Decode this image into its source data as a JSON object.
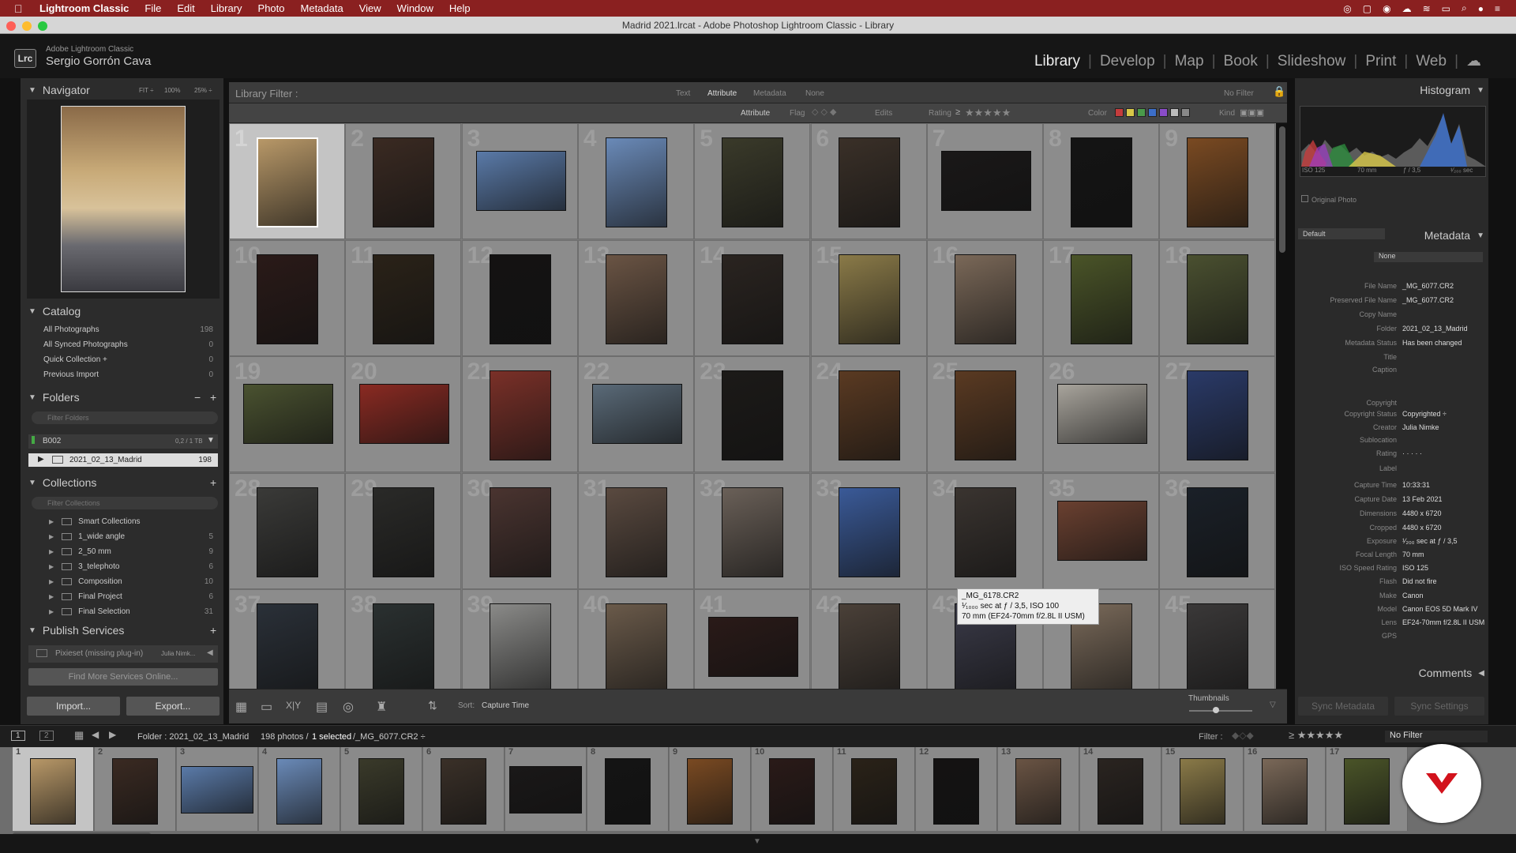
{
  "menubar": {
    "app_name": "Lightroom Classic",
    "items": [
      "File",
      "Edit",
      "Library",
      "Photo",
      "Metadata",
      "View",
      "Window",
      "Help"
    ]
  },
  "window_title": "Madrid 2021.lrcat - Adobe Photoshop Lightroom Classic - Library",
  "identity": {
    "logo": "Lrc",
    "product": "Adobe Lightroom Classic",
    "user": "Sergio Gorrón Cava"
  },
  "modules": {
    "items": [
      "Library",
      "Develop",
      "Map",
      "Book",
      "Slideshow",
      "Print",
      "Web"
    ],
    "active": "Library"
  },
  "navigator": {
    "title": "Navigator",
    "zoom_options": [
      "FIT ÷",
      "100%",
      "25% ÷"
    ]
  },
  "catalog": {
    "title": "Catalog",
    "items": [
      {
        "label": "All Photographs",
        "count": "198"
      },
      {
        "label": "All Synced Photographs",
        "count": "0"
      },
      {
        "label": "Quick Collection +",
        "count": "0"
      },
      {
        "label": "Previous Import",
        "count": "0"
      }
    ]
  },
  "folders": {
    "title": "Folders",
    "search_placeholder": "Filter Folders",
    "volume": {
      "name": "B002",
      "usage": "0,2 / 1 TB"
    },
    "folder": {
      "name": "2021_02_13_Madrid",
      "count": "198"
    }
  },
  "collections": {
    "title": "Collections",
    "search_placeholder": "Filter Collections",
    "items": [
      {
        "label": "Smart Collections",
        "count": ""
      },
      {
        "label": "1_wide angle",
        "count": "5"
      },
      {
        "label": "2_50 mm",
        "count": "9"
      },
      {
        "label": "3_telephoto",
        "count": "6"
      },
      {
        "label": "Composition",
        "count": "10"
      },
      {
        "label": "Final Project",
        "count": "6"
      },
      {
        "label": "Final Selection",
        "count": "31"
      }
    ]
  },
  "publish": {
    "title": "Publish Services",
    "service": "Pixieset (missing plug-in)",
    "service_user": "Julia Nimk...",
    "find_more": "Find More Services Online..."
  },
  "left_buttons": {
    "import": "Import...",
    "export": "Export..."
  },
  "library_filter": {
    "label": "Library Filter :",
    "tabs": [
      "Text",
      "Attribute",
      "Metadata",
      "None"
    ],
    "active_tab": "Attribute",
    "preset": "No Filter",
    "attribute_label": "Attribute",
    "flag_label": "Flag",
    "edits_label": "Edits",
    "rating_label": "Rating",
    "rating_op": "≥",
    "rating_stars": "★★★★★",
    "color_label": "Color",
    "kind_label": "Kind"
  },
  "grid": {
    "selected_index": 1,
    "cells": [
      {
        "n": "1",
        "c": "#b89868",
        "o": "v"
      },
      {
        "n": "2",
        "c": "#3a2a22",
        "o": "v"
      },
      {
        "n": "3",
        "c": "#5a7aa8",
        "o": "h"
      },
      {
        "n": "4",
        "c": "#6a8ab8",
        "o": "v"
      },
      {
        "n": "5",
        "c": "#3a3a2a",
        "o": "v"
      },
      {
        "n": "6",
        "c": "#3a3028",
        "o": "v"
      },
      {
        "n": "7",
        "c": "#1a1818",
        "o": "h"
      },
      {
        "n": "8",
        "c": "#141414",
        "o": "v"
      },
      {
        "n": "9",
        "c": "#7a4a22",
        "o": "v"
      },
      {
        "n": "10",
        "c": "#2a1a18",
        "o": "v"
      },
      {
        "n": "11",
        "c": "#2a2218",
        "o": "v"
      },
      {
        "n": "12",
        "c": "#141212",
        "o": "v"
      },
      {
        "n": "13",
        "c": "#6a5444",
        "o": "v"
      },
      {
        "n": "14",
        "c": "#2a2420",
        "o": "v"
      },
      {
        "n": "15",
        "c": "#8a7a48",
        "o": "v"
      },
      {
        "n": "16",
        "c": "#7a6858",
        "o": "v"
      },
      {
        "n": "17",
        "c": "#4a5428",
        "o": "v"
      },
      {
        "n": "18",
        "c": "#4a5030",
        "o": "v"
      },
      {
        "n": "19",
        "c": "#4a5230",
        "o": "h"
      },
      {
        "n": "20",
        "c": "#8a2a22",
        "o": "h"
      },
      {
        "n": "21",
        "c": "#7a3028",
        "o": "v"
      },
      {
        "n": "22",
        "c": "#5a6a78",
        "o": "h"
      },
      {
        "n": "23",
        "c": "#1c1a18",
        "o": "v"
      },
      {
        "n": "24",
        "c": "#5a3a22",
        "o": "v"
      },
      {
        "n": "25",
        "c": "#5a3a22",
        "o": "v"
      },
      {
        "n": "26",
        "c": "#a8a49c",
        "o": "h"
      },
      {
        "n": "27",
        "c": "#2a3a68",
        "o": "v"
      },
      {
        "n": "28",
        "c": "#3a3a38",
        "o": "v"
      },
      {
        "n": "29",
        "c": "#2a2a28",
        "o": "v"
      },
      {
        "n": "30",
        "c": "#4a3430",
        "o": "v"
      },
      {
        "n": "31",
        "c": "#5a4a40",
        "o": "v"
      },
      {
        "n": "32",
        "c": "#6a6058",
        "o": "v"
      },
      {
        "n": "33",
        "c": "#3a5a98",
        "o": "v"
      },
      {
        "n": "34",
        "c": "#3a3430",
        "o": "v"
      },
      {
        "n": "35",
        "c": "#6a4030",
        "o": "h"
      },
      {
        "n": "36",
        "c": "#1a2028",
        "o": "v"
      },
      {
        "n": "37",
        "c": "#2a3038",
        "o": "v"
      },
      {
        "n": "38",
        "c": "#2a3030",
        "o": "v"
      },
      {
        "n": "39",
        "c": "#8a8a88",
        "o": "v"
      },
      {
        "n": "40",
        "c": "#6a5a4a",
        "o": "v"
      },
      {
        "n": "41",
        "c": "#2a1a18",
        "o": "h"
      },
      {
        "n": "42",
        "c": "#4a4038",
        "o": "v"
      },
      {
        "n": "43",
        "c": "#3a3a48",
        "o": "v"
      },
      {
        "n": "44",
        "c": "#7a6a5a",
        "o": "v"
      },
      {
        "n": "45",
        "c": "#3a3838",
        "o": "v"
      }
    ]
  },
  "tooltip": {
    "line1": "_MG_6178.CR2",
    "line2": "¹⁄₁₀₀₀ sec at ƒ / 3,5, ISO 100",
    "line3": "70 mm (EF24-70mm f/2.8L II USM)"
  },
  "toolbar": {
    "sort_label": "Sort:",
    "sort_value": "Capture Time",
    "thumbnails_label": "Thumbnails"
  },
  "histogram": {
    "title": "Histogram",
    "iso": "ISO 125",
    "focal": "70 mm",
    "aperture": "ƒ / 3,5",
    "shutter": "¹⁄₂₀₀ sec",
    "original_photo": "Original Photo"
  },
  "metadata": {
    "title": "Metadata",
    "preset_dropdown": "Default",
    "preset_label": "Preset",
    "preset_value": "None",
    "fields": [
      {
        "label": "File Name",
        "value": "_MG_6077.CR2"
      },
      {
        "label": "Preserved File Name",
        "value": "_MG_6077.CR2"
      },
      {
        "label": "Copy Name",
        "value": ""
      },
      {
        "label": "Folder",
        "value": "2021_02_13_Madrid"
      },
      {
        "label": "Metadata Status",
        "value": "Has been changed"
      },
      {
        "label": "Title",
        "value": ""
      },
      {
        "label": "Caption",
        "value": ""
      },
      {
        "label": "Copyright",
        "value": ""
      },
      {
        "label": "Copyright Status",
        "value": "Copyrighted ÷"
      },
      {
        "label": "Creator",
        "value": "Julia Nimke"
      },
      {
        "label": "Sublocation",
        "value": ""
      },
      {
        "label": "Rating",
        "value": "· · · · ·"
      },
      {
        "label": "Label",
        "value": ""
      },
      {
        "label": "Capture Time",
        "value": "10:33:31"
      },
      {
        "label": "Capture Date",
        "value": "13 Feb 2021"
      },
      {
        "label": "Dimensions",
        "value": "4480 x 6720"
      },
      {
        "label": "Cropped",
        "value": "4480 x 6720"
      },
      {
        "label": "Exposure",
        "value": "¹⁄₂₀₀ sec at ƒ / 3,5"
      },
      {
        "label": "Focal Length",
        "value": "70 mm"
      },
      {
        "label": "ISO Speed Rating",
        "value": "ISO 125"
      },
      {
        "label": "Flash",
        "value": "Did not fire"
      },
      {
        "label": "Make",
        "value": "Canon"
      },
      {
        "label": "Model",
        "value": "Canon EOS 5D Mark IV"
      },
      {
        "label": "Lens",
        "value": "EF24-70mm f/2.8L II USM"
      },
      {
        "label": "GPS",
        "value": ""
      }
    ],
    "comments": "Comments",
    "sync_metadata": "Sync Metadata",
    "sync_settings": "Sync Settings"
  },
  "filmstrip": {
    "views": [
      "1",
      "2"
    ],
    "path": "Folder : 2021_02_13_Madrid",
    "photo_count": "198 photos /",
    "selected": "1 selected",
    "file": "/_MG_6077.CR2 ÷",
    "filter_label": "Filter :",
    "filter_value": "No Filter",
    "frames": [
      {
        "n": "1",
        "c": "#b89868",
        "o": "v"
      },
      {
        "n": "2",
        "c": "#3a2a22",
        "o": "v"
      },
      {
        "n": "3",
        "c": "#5a7aa8",
        "o": "h"
      },
      {
        "n": "4",
        "c": "#6a8ab8",
        "o": "v"
      },
      {
        "n": "5",
        "c": "#3a3a2a",
        "o": "v"
      },
      {
        "n": "6",
        "c": "#3a3028",
        "o": "v"
      },
      {
        "n": "7",
        "c": "#1a1818",
        "o": "h"
      },
      {
        "n": "8",
        "c": "#141414",
        "o": "v"
      },
      {
        "n": "9",
        "c": "#7a4a22",
        "o": "v"
      },
      {
        "n": "10",
        "c": "#2a1a18",
        "o": "v"
      },
      {
        "n": "11",
        "c": "#2a2218",
        "o": "v"
      },
      {
        "n": "12",
        "c": "#141212",
        "o": "v"
      },
      {
        "n": "13",
        "c": "#6a5444",
        "o": "v"
      },
      {
        "n": "14",
        "c": "#2a2420",
        "o": "v"
      },
      {
        "n": "15",
        "c": "#8a7a48",
        "o": "v"
      },
      {
        "n": "16",
        "c": "#7a6858",
        "o": "v"
      },
      {
        "n": "17",
        "c": "#4a5428",
        "o": "v"
      }
    ]
  }
}
